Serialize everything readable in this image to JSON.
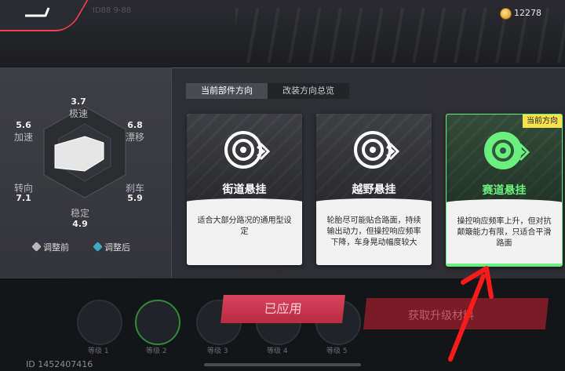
{
  "header": {
    "coins": "12278",
    "blurred_title": "ID88 9-88"
  },
  "stats": {
    "top": {
      "value": "3.7",
      "label": "极速"
    },
    "top_right": {
      "value": "6.8",
      "label": "漂移"
    },
    "right": {
      "value": "5.9",
      "label": "刹车"
    },
    "bottom": {
      "value": "4.9",
      "label": "稳定"
    },
    "left_bottom": {
      "value": "7.1",
      "label": "转向"
    },
    "left_top": {
      "value": "5.6",
      "label": "加速"
    }
  },
  "legend": {
    "before": "调整前",
    "after": "调整后",
    "before_color": "#b8b8b8",
    "after_color": "#3fa7c9"
  },
  "tabs": [
    {
      "label": "当前部件方向",
      "active": true
    },
    {
      "label": "改装方向总览",
      "active": false
    }
  ],
  "cards": [
    {
      "title": "街道悬挂",
      "desc": "适合大部分路况的通用型设定",
      "icon": "brake-disc-icon",
      "selected": false
    },
    {
      "title": "越野悬挂",
      "desc": "轮胎尽可能贴合路面，持续输出动力，但操控响应频率下降，车身晃动幅度较大",
      "icon": "brake-disc-icon",
      "selected": false
    },
    {
      "title": "赛道悬挂",
      "desc": "操控响应频率上升，但对抗颠簸能力有限，只适合平滑路面",
      "icon": "brake-disc-icon",
      "selected": true,
      "badge": "当前方向"
    }
  ],
  "bottom": {
    "apply_label": "已应用",
    "blurred_action": "获取升级材料",
    "player_id": "ID 1452407416",
    "slot_labels": [
      "等级 1",
      "等级 2",
      "等级 3",
      "等级 4",
      "等级 5"
    ]
  },
  "colors": {
    "accent_green": "#6bf07f",
    "accent_red": "#d7435a",
    "badge_yellow": "#f7e24b",
    "annotation_arrow": "#ff1a1a"
  }
}
